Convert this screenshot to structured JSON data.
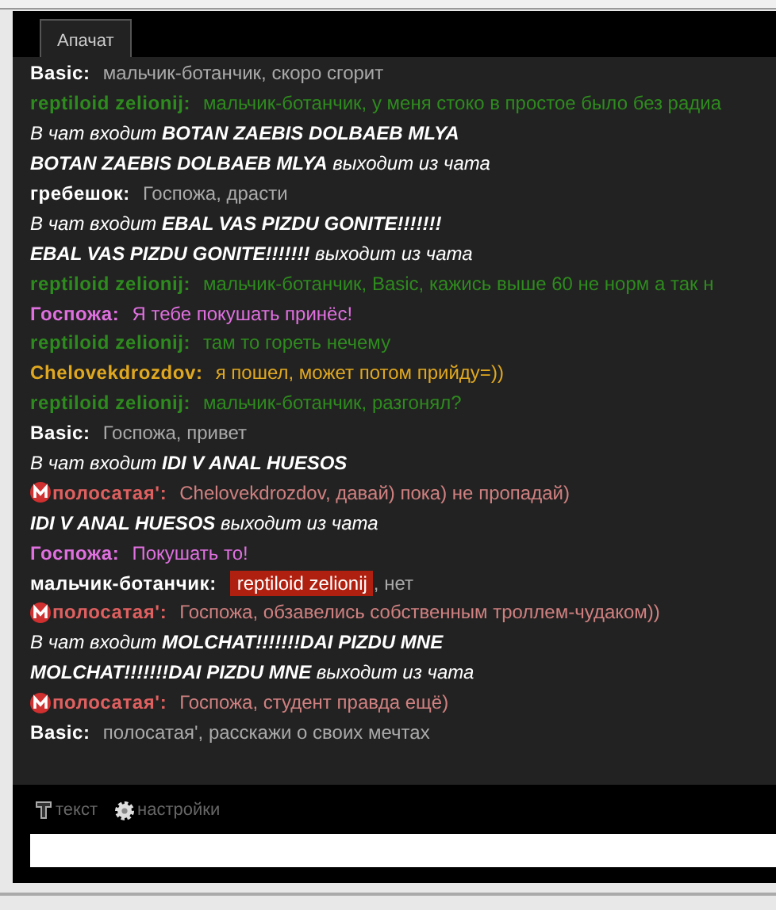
{
  "tabs": [
    {
      "label": "Апачат",
      "selected": true
    }
  ],
  "messages": [
    {
      "kind": "message",
      "author": "Basic:",
      "text": "мальчик-ботанчик, скоро сгорит",
      "color": "#ffffff",
      "moderator": false
    },
    {
      "kind": "message",
      "author": "reptiloid zelionij:",
      "text": "мальчик-ботанчик, у меня стоко в простое было без радиа",
      "color": "#2e8b1e",
      "moderator": false
    },
    {
      "kind": "join",
      "prefix": "В чат входит",
      "name": "BOTAN ZAEBIS DOLBAEB MLYA"
    },
    {
      "kind": "leave",
      "name": "BOTAN ZAEBIS DOLBAEB MLYA",
      "suffix": "выходит из чата"
    },
    {
      "kind": "message",
      "author": "гребешок:",
      "text": "Госпожа, драсти",
      "color": "#ffffff",
      "moderator": false
    },
    {
      "kind": "join",
      "prefix": "В чат входит",
      "name": "EBAL VAS PIZDU GONITE!!!!!!!"
    },
    {
      "kind": "leave",
      "name": "EBAL VAS PIZDU GONITE!!!!!!!",
      "suffix": "выходит из чата"
    },
    {
      "kind": "message",
      "author": "reptiloid zelionij:",
      "text": "мальчик-ботанчик, Basic, кажись выше 60 не норм а так н",
      "color": "#2e8b1e",
      "moderator": false
    },
    {
      "kind": "message",
      "author": "Госпожа:",
      "text": "Я тебе покушать принёс!",
      "color": "#e070e0",
      "moderator": false
    },
    {
      "kind": "message",
      "author": "reptiloid zelionij:",
      "text": "там то гореть нечему",
      "color": "#2e8b1e",
      "moderator": false
    },
    {
      "kind": "message",
      "author": "Chelovekdrozdov:",
      "text": "я пошел, может потом прийду=))",
      "color": "#e0a820",
      "moderator": false
    },
    {
      "kind": "message",
      "author": "reptiloid zelionij:",
      "text": "мальчик-ботанчик, разгонял?",
      "color": "#2e8b1e",
      "moderator": false
    },
    {
      "kind": "message",
      "author": "Basic:",
      "text": "Госпожа, привет",
      "color": "#ffffff",
      "moderator": false
    },
    {
      "kind": "join",
      "prefix": "В чат входит",
      "name": "IDI V ANAL HUESOS"
    },
    {
      "kind": "message",
      "author": "полосатая':",
      "text": "Chelovekdrozdov, давай) пока) не пропадай)",
      "color": "#e06060",
      "moderator": true
    },
    {
      "kind": "leave",
      "name": "IDI V ANAL HUESOS",
      "suffix": "выходит из чата"
    },
    {
      "kind": "message",
      "author": "Госпожа:",
      "text": "Покушать то!",
      "color": "#e070e0",
      "moderator": false
    },
    {
      "kind": "message",
      "author": "мальчик-ботанчик:",
      "mention": "reptiloid zelionij",
      "text": ", нет",
      "color": "#ffffff",
      "moderator": false
    },
    {
      "kind": "message",
      "author": "полосатая':",
      "text": "Госпожа, обзавелись собственным троллем-чудаком))",
      "color": "#e06060",
      "moderator": true
    },
    {
      "kind": "join",
      "prefix": "В чат входит",
      "name": "MOLCHAT!!!!!!!DAI PIZDU MNE"
    },
    {
      "kind": "leave",
      "name": "MOLCHAT!!!!!!!DAI PIZDU MNE",
      "suffix": "выходит из чата"
    },
    {
      "kind": "message",
      "author": "полосатая':",
      "text": "Госпожа, студент правда ещё)",
      "color": "#e06060",
      "moderator": true
    },
    {
      "kind": "message",
      "author": "Basic:",
      "text": "полосатая', расскажи о своих мечтах",
      "color": "#ffffff",
      "moderator": false
    }
  ],
  "toolbar": [
    {
      "kind": "text",
      "label": "текст"
    },
    {
      "kind": "settings",
      "label": "настройки"
    }
  ]
}
